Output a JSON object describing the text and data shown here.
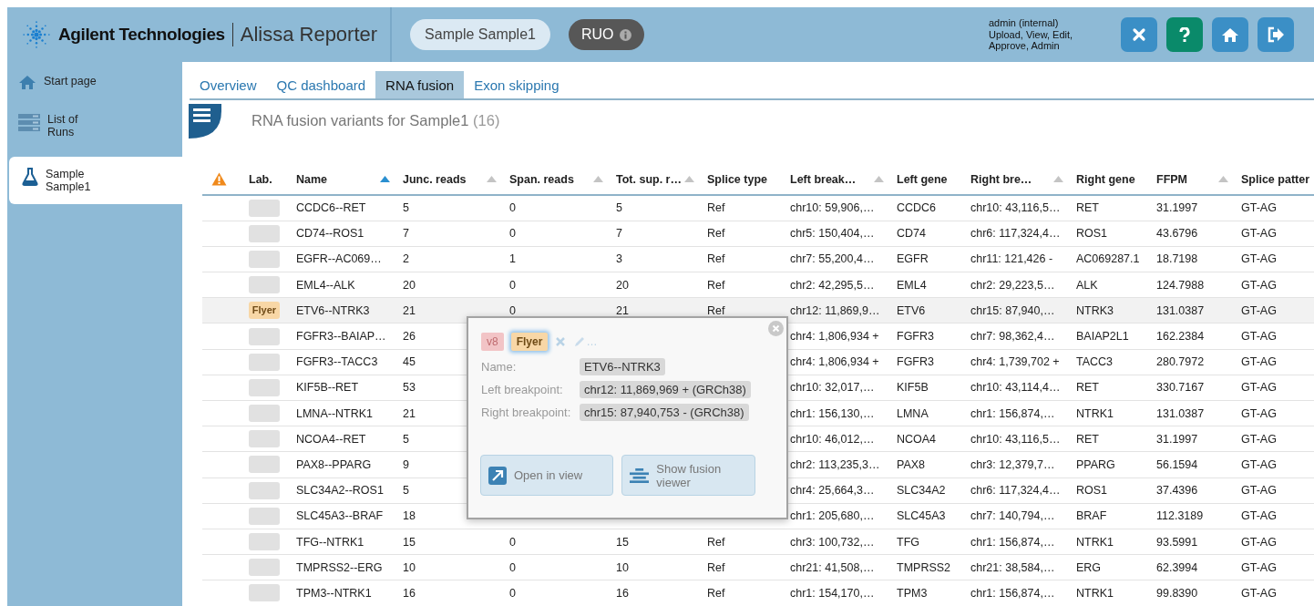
{
  "header": {
    "logo": "Agilent Technologies",
    "app_name": "Alissa Reporter",
    "sample_pill": "Sample Sample1",
    "ruo_badge": "RUO",
    "user": {
      "role": "admin (internal)",
      "permissions": "Upload, View, Edit, Approve, Admin"
    },
    "buttons": [
      {
        "kind": "close"
      },
      {
        "kind": "help"
      },
      {
        "kind": "home"
      },
      {
        "kind": "logout"
      }
    ]
  },
  "sidebar": {
    "items": [
      {
        "kind": "home",
        "label": "Start page",
        "selected": false
      },
      {
        "kind": "runs",
        "label": "List of\nRuns",
        "selected": false
      },
      {
        "kind": "sample",
        "label": "Sample\nSample1",
        "selected": true
      }
    ]
  },
  "tabs": [
    {
      "label": "Overview",
      "selected": false
    },
    {
      "label": "QC dashboard",
      "selected": false
    },
    {
      "label": "RNA fusion",
      "selected": true
    },
    {
      "label": "Exon skipping",
      "selected": false
    }
  ],
  "section": {
    "title": "RNA fusion variants for Sample1",
    "count": "(16)"
  },
  "table": {
    "columns": [
      {
        "kind": "warning"
      },
      {
        "kind": "text",
        "label": "Lab."
      },
      {
        "kind": "sortable",
        "label": "Name",
        "sorted": true
      },
      {
        "kind": "sortable",
        "label": "Junc. reads",
        "sorted": false
      },
      {
        "kind": "sortable",
        "label": "Span. reads",
        "sorted": false
      },
      {
        "kind": "sortable",
        "label": "Tot. sup. r…",
        "sorted": false
      },
      {
        "kind": "text",
        "label": "Splice type"
      },
      {
        "kind": "sortable",
        "label": "Left break…",
        "sorted": false
      },
      {
        "kind": "text",
        "label": "Left gene"
      },
      {
        "kind": "sortable",
        "label": "Right bre…",
        "sorted": false
      },
      {
        "kind": "text",
        "label": "Right gene"
      },
      {
        "kind": "sortable",
        "label": "FFPM",
        "sorted": false
      },
      {
        "kind": "text",
        "label": "Splice patter"
      }
    ],
    "rows": [
      {
        "selected": false,
        "cells": [
          "",
          "",
          "CCDC6--RET",
          "5",
          "0",
          "5",
          "Ref",
          "chr10: 59,906,…",
          "CCDC6",
          "chr10: 43,116,5…",
          "RET",
          "31.1997",
          "GT-AG"
        ]
      },
      {
        "selected": false,
        "cells": [
          "",
          "",
          "CD74--ROS1",
          "7",
          "0",
          "7",
          "Ref",
          "chr5: 150,404,…",
          "CD74",
          "chr6: 117,324,4…",
          "ROS1",
          "43.6796",
          "GT-AG"
        ]
      },
      {
        "selected": false,
        "cells": [
          "",
          "",
          "EGFR--AC069…",
          "2",
          "1",
          "3",
          "Ref",
          "chr7: 55,200,4…",
          "EGFR",
          "chr11: 121,426 -",
          "AC069287.1",
          "18.7198",
          "GT-AG"
        ]
      },
      {
        "selected": false,
        "cells": [
          "",
          "",
          "EML4--ALK",
          "20",
          "0",
          "20",
          "Ref",
          "chr2: 42,295,5…",
          "EML4",
          "chr2: 29,223,5…",
          "ALK",
          "124.7988",
          "GT-AG"
        ]
      },
      {
        "selected": true,
        "cells": [
          "",
          "Flyer",
          "ETV6--NTRK3",
          "21",
          "0",
          "21",
          "Ref",
          "chr12: 11,869,9…",
          "ETV6",
          "chr15: 87,940,…",
          "NTRK3",
          "131.0387",
          "GT-AG"
        ]
      },
      {
        "selected": false,
        "cells": [
          "",
          "",
          "FGFR3--BAIAP…",
          "26",
          null,
          null,
          null,
          "chr4: 1,806,934 +",
          "FGFR3",
          "chr7: 98,362,4…",
          "BAIAP2L1",
          "162.2384",
          "GT-AG"
        ]
      },
      {
        "selected": false,
        "cells": [
          "",
          "",
          "FGFR3--TACC3",
          "45",
          null,
          null,
          null,
          "chr4: 1,806,934 +",
          "FGFR3",
          "chr4: 1,739,702 +",
          "TACC3",
          "280.7972",
          "GT-AG"
        ]
      },
      {
        "selected": false,
        "cells": [
          "",
          "",
          "KIF5B--RET",
          "53",
          null,
          null,
          null,
          "chr10: 32,017,…",
          "KIF5B",
          "chr10: 43,114,4…",
          "RET",
          "330.7167",
          "GT-AG"
        ]
      },
      {
        "selected": false,
        "cells": [
          "",
          "",
          "LMNA--NTRK1",
          "21",
          null,
          null,
          null,
          "chr1: 156,130,…",
          "LMNA",
          "chr1: 156,874,…",
          "NTRK1",
          "131.0387",
          "GT-AG"
        ]
      },
      {
        "selected": false,
        "cells": [
          "",
          "",
          "NCOA4--RET",
          "5",
          null,
          null,
          null,
          "chr10: 46,012,…",
          "NCOA4",
          "chr10: 43,116,5…",
          "RET",
          "31.1997",
          "GT-AG"
        ]
      },
      {
        "selected": false,
        "cells": [
          "",
          "",
          "PAX8--PPARG",
          "9",
          null,
          null,
          null,
          "chr2: 113,235,3…",
          "PAX8",
          "chr3: 12,379,7…",
          "PPARG",
          "56.1594",
          "GT-AG"
        ]
      },
      {
        "selected": false,
        "cells": [
          "",
          "",
          "SLC34A2--ROS1",
          "5",
          null,
          null,
          null,
          "chr4: 25,664,3…",
          "SLC34A2",
          "chr6: 117,324,4…",
          "ROS1",
          "37.4396",
          "GT-AG"
        ]
      },
      {
        "selected": false,
        "cells": [
          "",
          "",
          "SLC45A3--BRAF",
          "18",
          null,
          null,
          null,
          "chr1: 205,680,…",
          "SLC45A3",
          "chr7: 140,794,…",
          "BRAF",
          "112.3189",
          "GT-AG"
        ]
      },
      {
        "selected": false,
        "cells": [
          "",
          "",
          "TFG--NTRK1",
          "15",
          "0",
          "15",
          "Ref",
          "chr3: 100,732,…",
          "TFG",
          "chr1: 156,874,…",
          "NTRK1",
          "93.5991",
          "GT-AG"
        ]
      },
      {
        "selected": false,
        "cells": [
          "",
          "",
          "TMPRSS2--ERG",
          "10",
          "0",
          "10",
          "Ref",
          "chr21: 41,508,…",
          "TMPRSS2",
          "chr21: 38,584,…",
          "ERG",
          "62.3994",
          "GT-AG"
        ]
      },
      {
        "selected": false,
        "cells": [
          "",
          "",
          "TPM3--NTRK1",
          "16",
          "0",
          "16",
          "Ref",
          "chr1: 154,170,…",
          "TPM3",
          "chr1: 156,874,…",
          "NTRK1",
          "99.8390",
          "GT-AG"
        ]
      }
    ]
  },
  "popup": {
    "tags": [
      {
        "label": "v8",
        "color": "#f2c4c6",
        "selected": false
      },
      {
        "label": "Flyer",
        "color": "#f8d7a6",
        "selected": true
      }
    ],
    "edit_more": "…",
    "fields": [
      {
        "label": "Name:",
        "value": "ETV6--NTRK3"
      },
      {
        "label": "Left breakpoint:",
        "value": "chr12: 11,869,969 + (GRCh38)"
      },
      {
        "label": "Right breakpoint:",
        "value": "chr15: 87,940,753 - (GRCh38)"
      }
    ],
    "buttons": [
      {
        "kind": "open",
        "label": "Open in view"
      },
      {
        "kind": "viewer",
        "label": "Show fusion viewer"
      }
    ]
  }
}
